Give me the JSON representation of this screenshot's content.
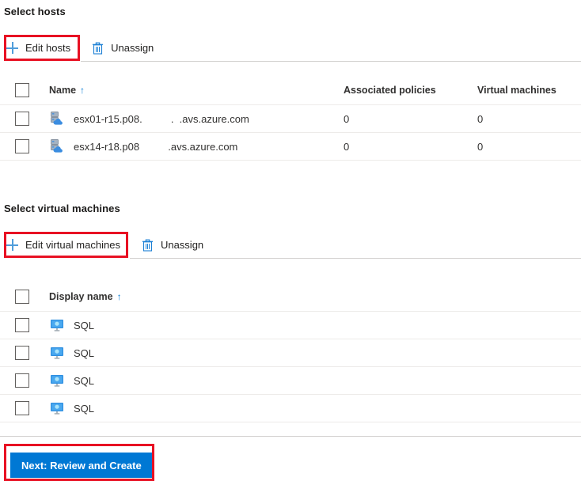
{
  "hosts_section": {
    "heading": "Select hosts",
    "toolbar": {
      "edit_label": "Edit hosts",
      "edit_icon": "plus-icon",
      "unassign_label": "Unassign",
      "unassign_icon": "trash-icon"
    },
    "table": {
      "columns": [
        "Name",
        "Associated policies",
        "Virtual machines"
      ],
      "sort_column": "Name",
      "sort_indicator": "↑",
      "rows": [
        {
          "icon": "host-cloud-icon",
          "name": "esx01-r15.p08.          .  .avs.azure.com",
          "associated_policies": "0",
          "virtual_machines": "0",
          "checked": false
        },
        {
          "icon": "host-cloud-icon",
          "name": "esx14-r18.p08          .avs.azure.com",
          "associated_policies": "0",
          "virtual_machines": "0",
          "checked": false
        }
      ]
    }
  },
  "vms_section": {
    "heading": "Select virtual machines",
    "toolbar": {
      "edit_label": "Edit virtual machines",
      "edit_icon": "plus-icon",
      "unassign_label": "Unassign",
      "unassign_icon": "trash-icon"
    },
    "table": {
      "columns": [
        "Display name"
      ],
      "sort_column": "Display name",
      "sort_indicator": "↑",
      "rows": [
        {
          "icon": "virtual-machine-icon",
          "display_name": "SQL",
          "checked": false
        },
        {
          "icon": "virtual-machine-icon",
          "display_name": "SQL",
          "checked": false
        },
        {
          "icon": "virtual-machine-icon",
          "display_name": "SQL",
          "checked": false
        },
        {
          "icon": "virtual-machine-icon",
          "display_name": "SQL",
          "checked": false
        }
      ]
    }
  },
  "footer": {
    "next_label": "Next: Review and Create"
  },
  "colors": {
    "accent": "#0078d4",
    "plus_icon": "#4f9ddb",
    "annotation": "#e81123",
    "row_border": "#edebe9",
    "divider": "#d2d0ce"
  }
}
